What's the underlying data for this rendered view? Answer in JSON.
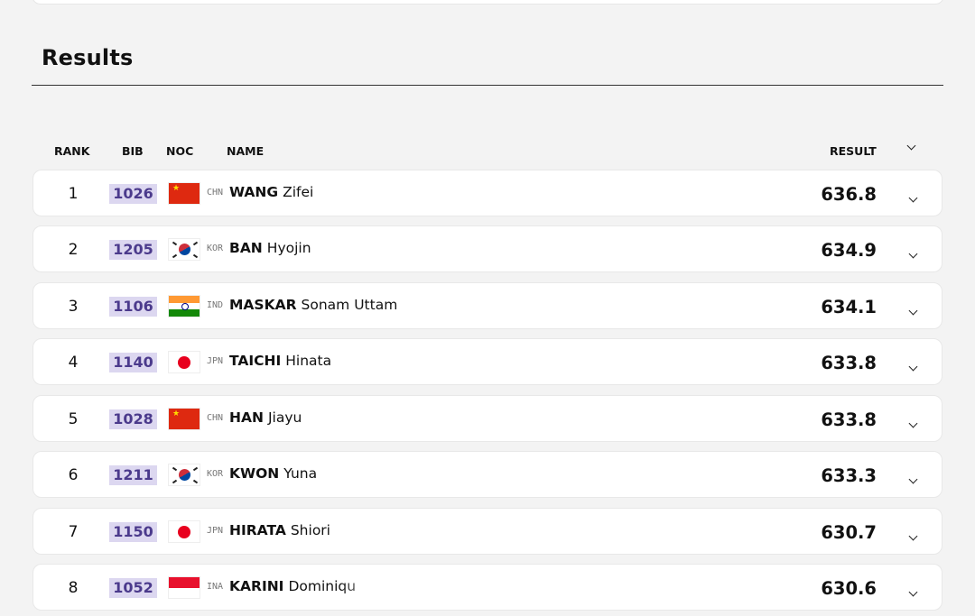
{
  "section": {
    "title": "Results"
  },
  "columns": {
    "rank": "RANK",
    "bib": "BIB",
    "noc": "NOC",
    "name": "NAME",
    "result": "RESULT"
  },
  "results": [
    {
      "rank": "1",
      "bib": "1026",
      "noc": "CHN",
      "surname": "WANG",
      "given": "Zifei",
      "result": "636.8",
      "flag": "flag-china"
    },
    {
      "rank": "2",
      "bib": "1205",
      "noc": "KOR",
      "surname": "BAN",
      "given": "Hyojin",
      "result": "634.9",
      "flag": "flag-korea"
    },
    {
      "rank": "3",
      "bib": "1106",
      "noc": "IND",
      "surname": "MASKAR",
      "given": "Sonam Uttam",
      "result": "634.1",
      "flag": "flag-india"
    },
    {
      "rank": "4",
      "bib": "1140",
      "noc": "JPN",
      "surname": "TAICHI",
      "given": "Hinata",
      "result": "633.8",
      "flag": "flag-japan"
    },
    {
      "rank": "5",
      "bib": "1028",
      "noc": "CHN",
      "surname": "HAN",
      "given": "Jiayu",
      "result": "633.8",
      "flag": "flag-china"
    },
    {
      "rank": "6",
      "bib": "1211",
      "noc": "KOR",
      "surname": "KWON",
      "given": "Yuna",
      "result": "633.3",
      "flag": "flag-korea"
    },
    {
      "rank": "7",
      "bib": "1150",
      "noc": "JPN",
      "surname": "HIRATA",
      "given": "Shiori",
      "result": "630.7",
      "flag": "flag-japan"
    },
    {
      "rank": "8",
      "bib": "1052",
      "noc": "INA",
      "surname": "KARINI",
      "given": "Dominiqu",
      "result": "630.6",
      "flag": "flag-indonesia"
    }
  ],
  "colors": {
    "bib_bg": "#dcd7f0",
    "bib_text": "#4b3a8c",
    "page_bg": "#f3f3f3"
  }
}
